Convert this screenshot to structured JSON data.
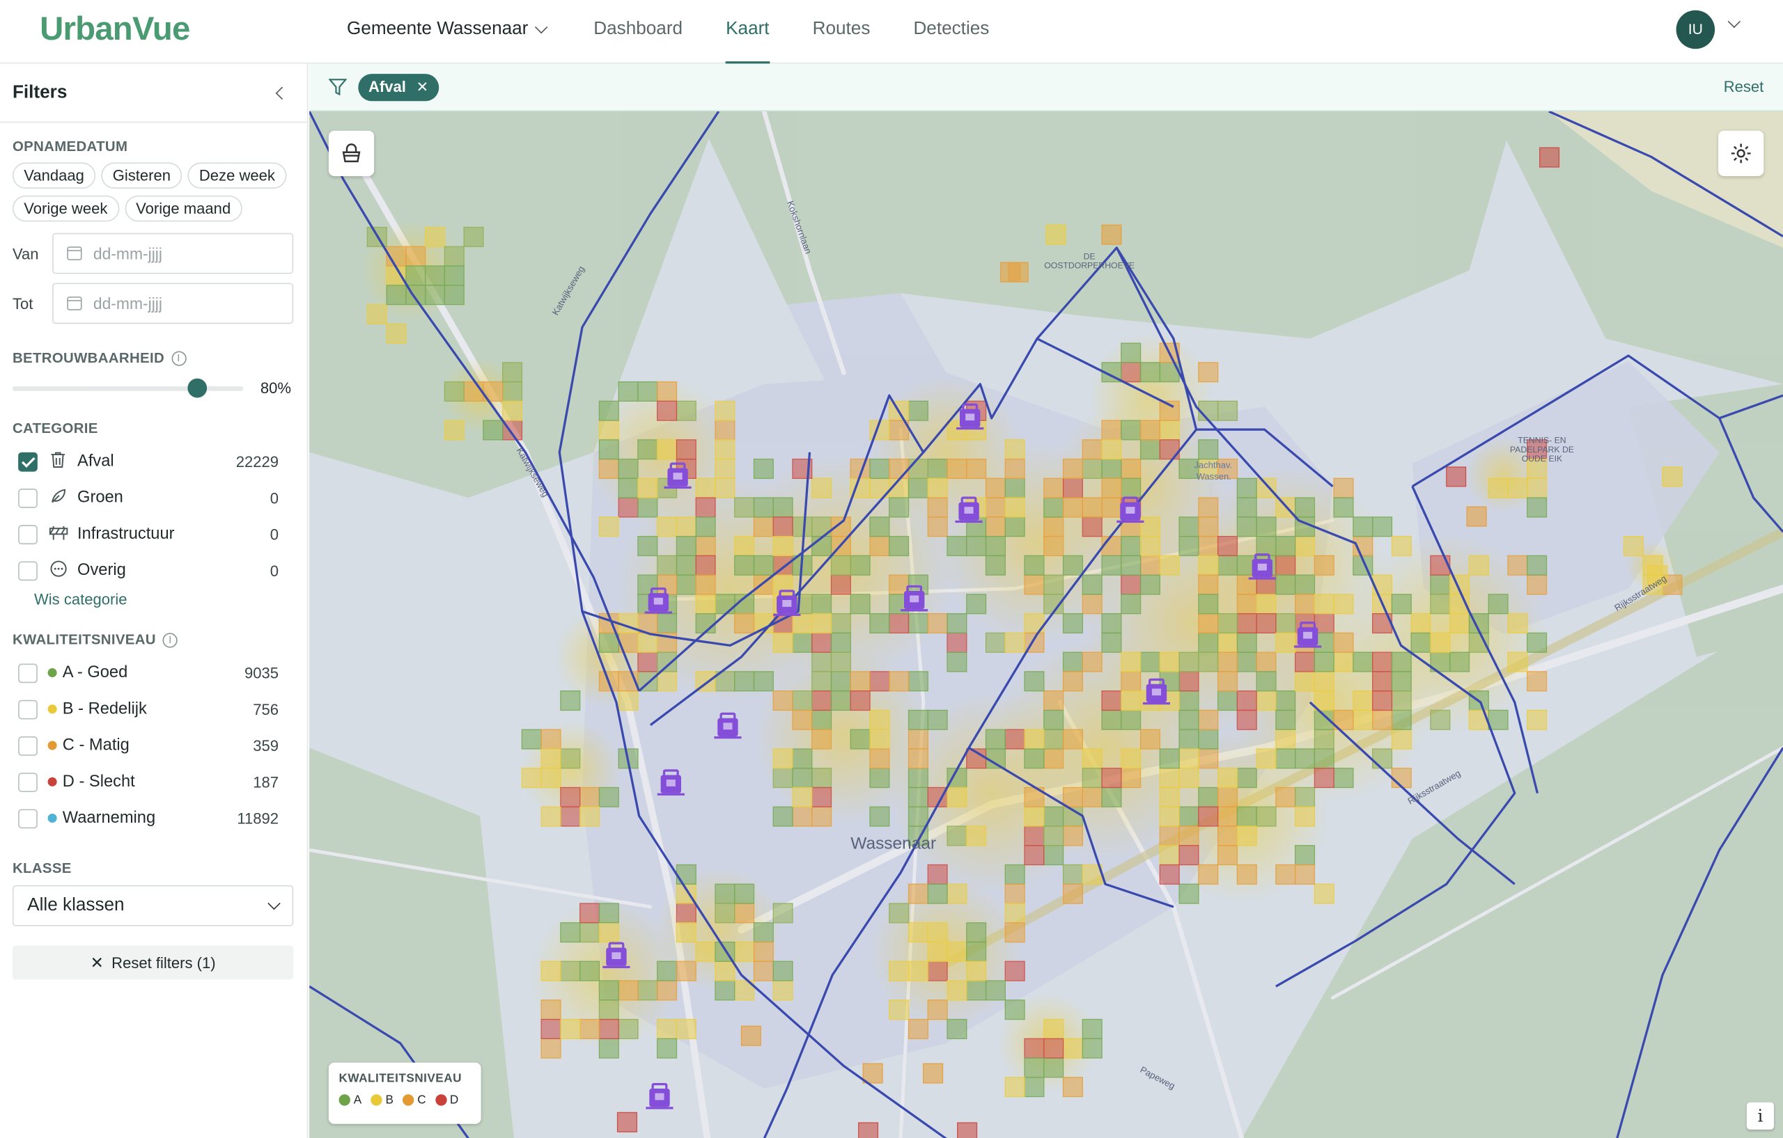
{
  "app": {
    "brand": "UrbanVue"
  },
  "header": {
    "org": "Gemeente Wassenaar",
    "nav": [
      "Dashboard",
      "Kaart",
      "Routes",
      "Detecties"
    ],
    "active_nav": "Kaart",
    "user_initials": "IU"
  },
  "sidebar": {
    "title": "Filters",
    "date": {
      "title": "OPNAMEDATUM",
      "chips": [
        "Vandaag",
        "Gisteren",
        "Deze week",
        "Vorige week",
        "Vorige maand"
      ],
      "from_label": "Van",
      "to_label": "Tot",
      "placeholder": "dd-mm-jjjj"
    },
    "confidence": {
      "title": "BETROUWBAARHEID",
      "value_label": "80%",
      "value": 0.8
    },
    "category": {
      "title": "CATEGORIE",
      "items": [
        {
          "label": "Afval",
          "count": "22229",
          "checked": true,
          "icon": "trash-icon"
        },
        {
          "label": "Groen",
          "count": "0",
          "checked": false,
          "icon": "leaf-icon"
        },
        {
          "label": "Infrastructuur",
          "count": "0",
          "checked": false,
          "icon": "barrier-icon"
        },
        {
          "label": "Overig",
          "count": "0",
          "checked": false,
          "icon": "more-circle-icon"
        }
      ],
      "clear_link": "Wis categorie"
    },
    "quality": {
      "title": "KWALITEITSNIVEAU",
      "items": [
        {
          "label": "A - Goed",
          "count": "9035",
          "color": "#6ea34a"
        },
        {
          "label": "B - Redelijk",
          "count": "756",
          "color": "#e8c93a"
        },
        {
          "label": "C - Matig",
          "count": "359",
          "color": "#e39a32"
        },
        {
          "label": "D - Slecht",
          "count": "187",
          "color": "#c8423a"
        },
        {
          "label": "Waarneming",
          "count": "11892",
          "color": "#4fb3d6"
        }
      ]
    },
    "klasse": {
      "title": "KLASSE",
      "value": "Alle klassen"
    },
    "reset_button": "Reset filters (1)"
  },
  "filterbar": {
    "active_filter": "Afval",
    "reset_label": "Reset"
  },
  "map": {
    "labels": {
      "town": "Wassenaar",
      "oostdorperhoeve": [
        "DE",
        "OOSTDORPERHOEVE"
      ],
      "tennis": [
        "TENNIS- EN",
        "PADELPARK DE",
        "OUDE EIK"
      ],
      "jachthaven": [
        "Jachthav.",
        "Wassen."
      ],
      "roads": [
        "Katwijkseweg",
        "Kokshornlaan",
        "Papeweg",
        "Rijksstraatweg",
        "Rijksstraatweg",
        "Katwijkseweg"
      ]
    },
    "legend": {
      "title": "KWALITEITSNIVEAU",
      "items": [
        {
          "label": "A",
          "color": "#6ea34a"
        },
        {
          "label": "B",
          "color": "#e8c93a"
        },
        {
          "label": "C",
          "color": "#e39a32"
        },
        {
          "label": "D",
          "color": "#c8423a"
        }
      ]
    },
    "info_label": "i",
    "colors": {
      "accent": "#2f6f67",
      "boundary": "#2a3aa8",
      "bin": "#7a3fd6"
    }
  }
}
